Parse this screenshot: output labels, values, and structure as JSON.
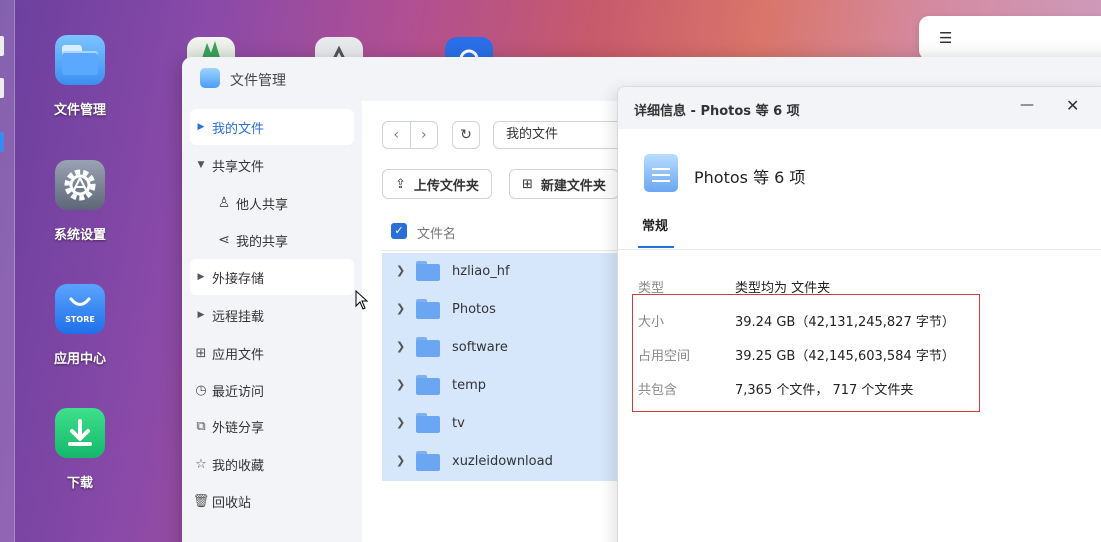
{
  "desktop": {
    "icons": [
      {
        "label": "文件管理",
        "icon": "folder-icon"
      },
      {
        "label": "系统设置",
        "icon": "gear-icon"
      },
      {
        "label": "应用中心",
        "icon": "store-icon",
        "badge": "STORE"
      },
      {
        "label": "下载",
        "icon": "download-icon"
      }
    ]
  },
  "search": {
    "icon": "filter-settings-icon"
  },
  "file_manager": {
    "title": "文件管理",
    "sidebar": {
      "items": [
        {
          "label": "我的文件",
          "icon": "caret-right-icon"
        },
        {
          "label": "共享文件",
          "icon": "caret-down-icon"
        },
        {
          "label": "他人共享",
          "icon": "users-icon"
        },
        {
          "label": "我的共享",
          "icon": "share-icon"
        },
        {
          "label": "外接存储",
          "icon": "caret-right-icon"
        },
        {
          "label": "远程挂载",
          "icon": "caret-right-icon"
        },
        {
          "label": "应用文件",
          "icon": "grid-icon"
        },
        {
          "label": "最近访问",
          "icon": "clock-icon"
        },
        {
          "label": "外链分享",
          "icon": "external-link-icon"
        },
        {
          "label": "我的收藏",
          "icon": "star-icon"
        },
        {
          "label": "回收站",
          "icon": "trash-icon"
        }
      ]
    },
    "toolbar": {
      "path": "我的文件",
      "upload_label": "上传文件夹",
      "new_folder_label": "新建文件夹"
    },
    "list": {
      "column_name": "文件名",
      "rows": [
        {
          "name": "hzliao_hf"
        },
        {
          "name": "Photos"
        },
        {
          "name": "software"
        },
        {
          "name": "temp"
        },
        {
          "name": "tv"
        },
        {
          "name": "xuzleidownload"
        }
      ]
    }
  },
  "details": {
    "title": "详细信息 - Photos 等 6 项",
    "header_name": "Photos 等 6 项",
    "tab": "常规",
    "props": [
      {
        "key": "类型",
        "value": "类型均为 文件夹"
      },
      {
        "key": "大小",
        "value": "39.24 GB（42,131,245,827 字节）"
      },
      {
        "key": "占用空间",
        "value": "39.25 GB（42,145,603,584 字节）"
      },
      {
        "key": "共包含",
        "value": "7,365 个文件， 717 个文件夹"
      }
    ]
  }
}
